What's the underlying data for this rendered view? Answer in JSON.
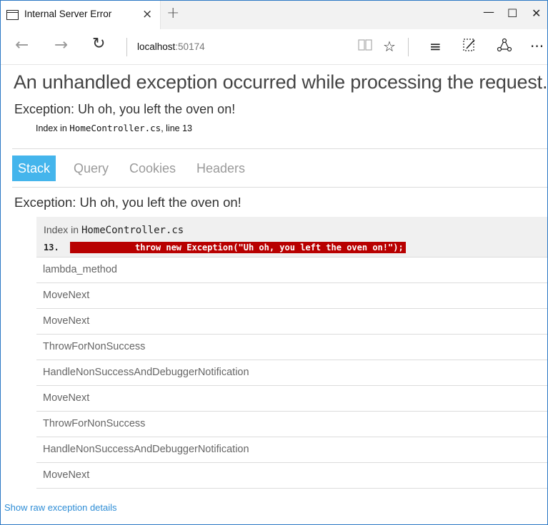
{
  "browser": {
    "tab": {
      "title": "Internal Server Error",
      "close": "×"
    },
    "new_tab": "+",
    "window_buttons": {
      "minimize": "—",
      "maximize": "☐",
      "close": "✕"
    },
    "nav": {
      "back": "←",
      "forward": "→",
      "refresh": "↻"
    },
    "url": {
      "host": "localhost",
      "port": ":50174"
    },
    "tools": {
      "reading_view": "📖",
      "favorite": "☆",
      "hub": "≡",
      "web_note": "✎",
      "share": "⌂",
      "more": "···"
    },
    "icons": [
      "tab-page-icon",
      "back-arrow-icon",
      "forward-arrow-icon",
      "refresh-icon",
      "reading-view-icon",
      "star-icon",
      "hub-icon",
      "web-note-icon",
      "share-icon",
      "more-icon"
    ]
  },
  "page": {
    "title": "An unhandled exception occurred while processing the request.",
    "exception": "Exception: Uh oh, you left the oven on!",
    "location": {
      "prefix": "Index in ",
      "file": "HomeController.cs",
      "suffix": ", line 13"
    },
    "tabs": [
      {
        "label": "Stack",
        "active": true
      },
      {
        "label": "Query",
        "active": false
      },
      {
        "label": "Cookies",
        "active": false
      },
      {
        "label": "Headers",
        "active": false
      }
    ],
    "stack": {
      "title": "Exception: Uh oh, you left the oven on!",
      "head": {
        "prefix": "Index in ",
        "file": "HomeController.cs",
        "line_no": "13.",
        "code": "throw new Exception(\"Uh oh, you left the oven on!\");"
      },
      "frames": [
        "lambda_method",
        "MoveNext",
        "MoveNext",
        "ThrowForNonSuccess",
        "HandleNonSuccessAndDebuggerNotification",
        "MoveNext",
        "ThrowForNonSuccess",
        "HandleNonSuccessAndDebuggerNotification",
        "MoveNext"
      ]
    },
    "raw_link": "Show raw exception details"
  },
  "colors": {
    "active_tab": "#44b5ec",
    "code_highlight": "#b80000",
    "link": "#2e8dd6",
    "window_border": "#2b78c5"
  }
}
